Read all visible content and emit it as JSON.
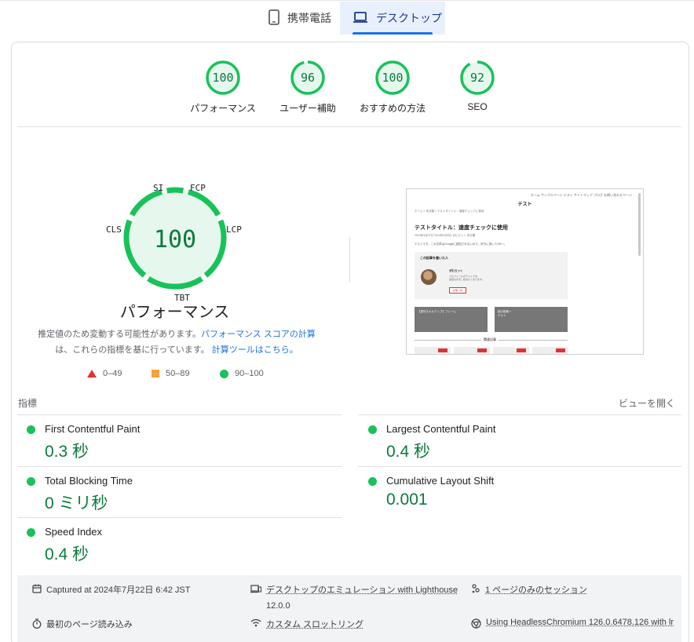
{
  "tabs": {
    "mobile": "携帯電話",
    "desktop": "デスクトップ"
  },
  "scores": [
    {
      "value": "100",
      "label": "パフォーマンス",
      "fraction": 1.0
    },
    {
      "value": "96",
      "label": "ユーザー補助",
      "fraction": 0.96
    },
    {
      "value": "100",
      "label": "おすすめの方法",
      "fraction": 1.0
    },
    {
      "value": "92",
      "label": "SEO",
      "fraction": 0.92
    }
  ],
  "big_gauge": {
    "score": "100",
    "title": "パフォーマンス",
    "labels": {
      "si": "SI",
      "fcp": "FCP",
      "lcp": "LCP",
      "tbt": "TBT",
      "cls": "CLS"
    }
  },
  "note": {
    "part1": "推定値のため変動する可能性があります。",
    "link1": "パフォーマンス スコアの計算",
    "part2": "は、これらの指標を基に行っています。",
    "link2": "計算ツールはこちら。"
  },
  "legend": {
    "fail": "0–49",
    "average": "50–89",
    "pass": "90–100"
  },
  "colors": {
    "pass": "#18c25a",
    "average": "#f6a33a",
    "fail": "#e8312c",
    "accent": "#1a73e8",
    "score_text": "#0c7a3d"
  },
  "thumbnail": {
    "nav": "ホーム  サンプルページ  テスト  サイトマップ  ブログ  お問い合わせページ",
    "site": "テスト",
    "breadcrumb": "ホーム > 未分類 > テストタイトル：速度チェックに使用",
    "title": "テストタイトル：速度チェックに使用",
    "meta": "2024年3月27日  2024年4月5日  ぜむらっく  未分類",
    "body": "テストです。この文章はGoogleに認知されないので、好きに書いてOK～。",
    "box_heading": "この記事を書いた人",
    "author": "ぜむらっく",
    "author_desc": "プロフィールのテストです。",
    "author_desc2": "適当な文字。読みたくなります。",
    "button": "記事一覧",
    "card1": "【週刊スキルアップ】フレーム",
    "card2": "前の投稿 >",
    "card2b": "テスト",
    "related": "関連記事"
  },
  "metrics": {
    "heading": "指標",
    "expand": "ビューを開く",
    "items": [
      {
        "name": "First Contentful Paint",
        "value": "0.3 秒"
      },
      {
        "name": "Largest Contentful Paint",
        "value": "0.4 秒"
      },
      {
        "name": "Total Blocking Time",
        "value": "0 ミリ秒"
      },
      {
        "name": "Cumulative Layout Shift",
        "value": "0.001"
      },
      {
        "name": "Speed Index",
        "value": "0.4 秒"
      }
    ]
  },
  "footer": {
    "captured": "Captured at 2024年7月22日 6:42 JST",
    "emulation": "デスクトップのエミュレーション with Lighthouse",
    "emulation_version": "12.0.0",
    "session": "1 ページのみのセッション",
    "initial_load": "最初のページ読み込み",
    "throttling": "カスタム スロットリング",
    "browser": "Using HeadlessChromium 126.0.6478.126 with lr"
  }
}
